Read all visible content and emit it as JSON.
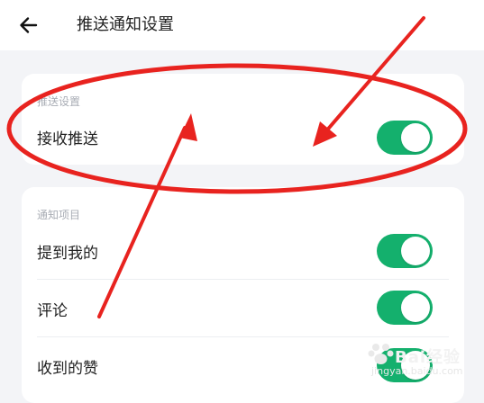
{
  "header": {
    "back_icon": "arrow-left-icon",
    "title": "推送通知设置"
  },
  "push_section": {
    "label": "推送设置",
    "items": [
      {
        "label": "接收推送",
        "enabled": true
      }
    ]
  },
  "notify_section": {
    "label": "通知项目",
    "items": [
      {
        "label": "提到我的",
        "enabled": true
      },
      {
        "label": "评论",
        "enabled": true
      },
      {
        "label": "收到的赞",
        "enabled": true
      }
    ]
  },
  "colors": {
    "toggle_on": "#14b06d",
    "annotation_red": "#e8231f",
    "page_background": "#f3f4f7"
  },
  "watermark": {
    "logo_icon": "baidu-paw-icon",
    "text": "Bai经验",
    "sub": "jingyan.baidu.com"
  }
}
